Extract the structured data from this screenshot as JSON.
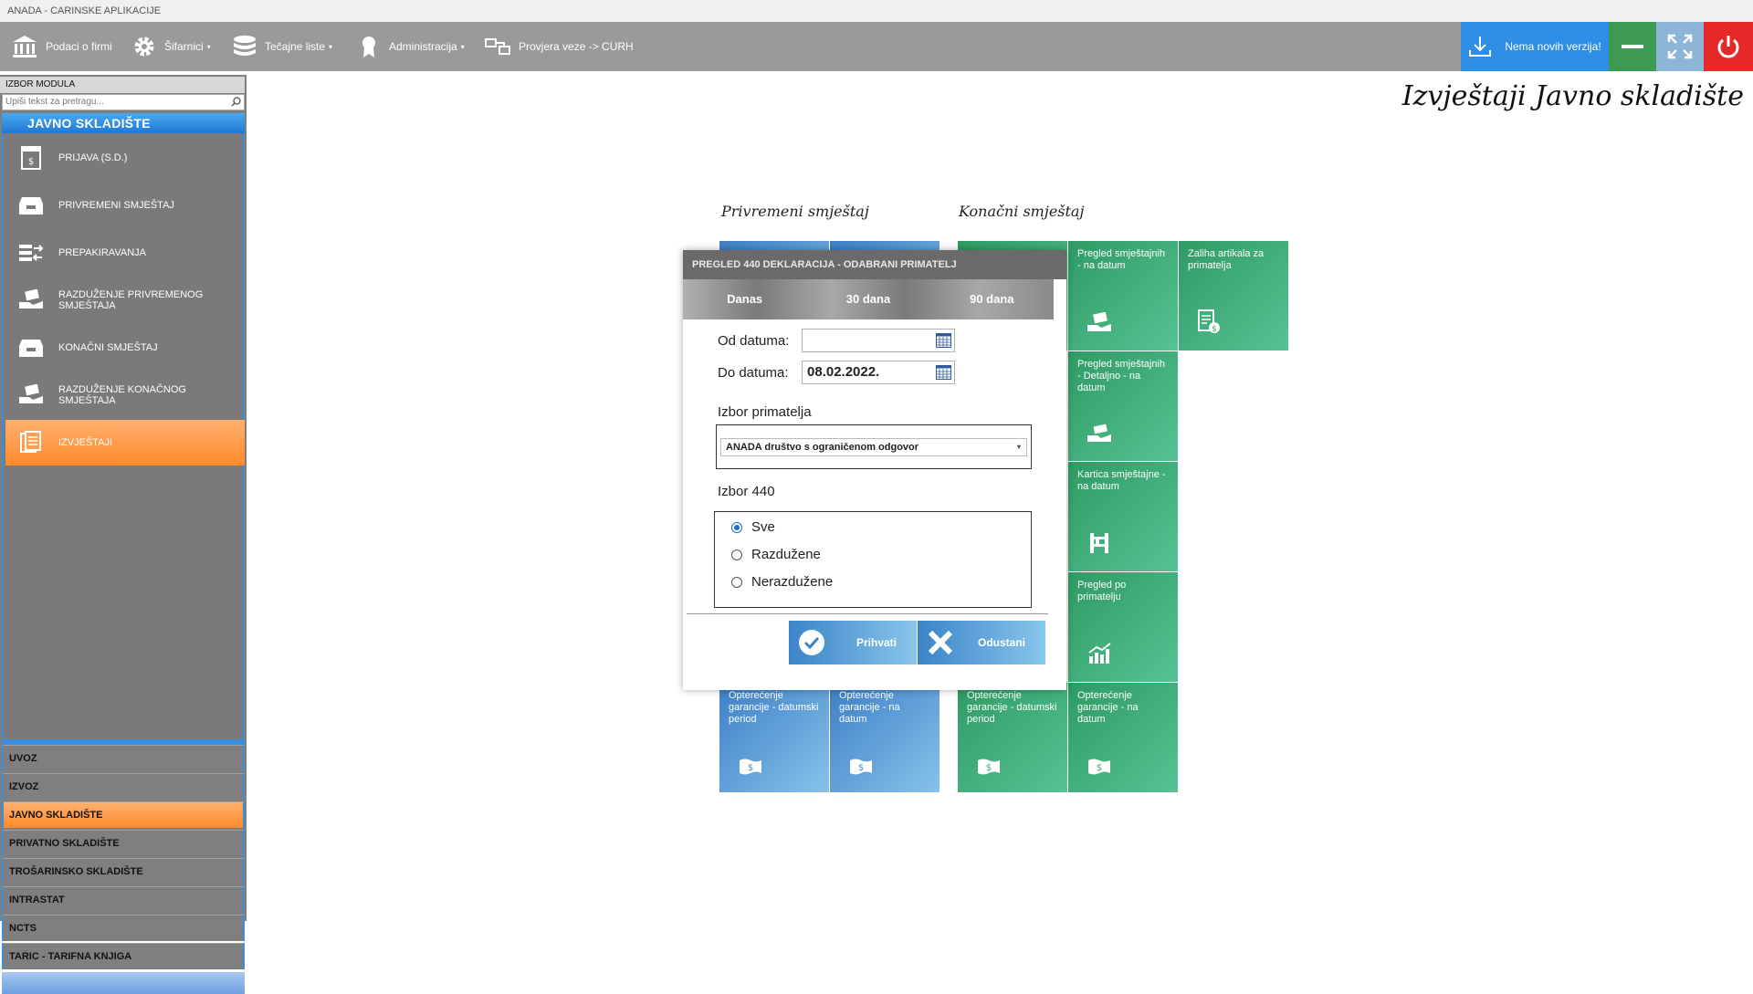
{
  "window_title": "ANADA - CARINSKE APLIKACIJE",
  "toolbar": {
    "items": [
      {
        "label": "Podaci o firmi",
        "icon": "bank-icon"
      },
      {
        "label": "Šifarnici",
        "icon": "gear-icon",
        "caret": "▾"
      },
      {
        "label": "Tečajne liste",
        "icon": "database-icon",
        "caret": "▾"
      },
      {
        "label": "Administracija",
        "icon": "award-icon",
        "caret": "▾"
      },
      {
        "label": "Provjera veze -> CURH",
        "icon": "network-icon"
      }
    ],
    "update_label": "Nema novih verzija!"
  },
  "sidebar": {
    "header": "IZBOR MODULA",
    "search_placeholder": "Upiši tekst za pretragu...",
    "module_title": "JAVNO SKLADIŠTE",
    "items": [
      {
        "label": "PRIJAVA (S.D.)",
        "icon": "document-dollar-icon"
      },
      {
        "label": "PRIVREMENI SMJEŠTAJ",
        "icon": "inbox-tray-icon"
      },
      {
        "label": "PREPAKIRAVANJA",
        "icon": "transfer-icon"
      },
      {
        "label": "RAZDUŽENJE PRIVREMENOG SMJEŠTAJA",
        "icon": "hand-box-icon"
      },
      {
        "label": "KONAČNI SMJEŠTAJ",
        "icon": "inbox-tray-icon"
      },
      {
        "label": "RAZDUŽENJE KONAČNOG SMJEŠTAJA",
        "icon": "hand-box-icon"
      },
      {
        "label": "IZVJEŠTAJI",
        "icon": "reports-icon",
        "active": true
      }
    ],
    "categories": [
      {
        "label": "UVOZ"
      },
      {
        "label": "IZVOZ"
      },
      {
        "label": "JAVNO SKLADIŠTE",
        "active": true
      },
      {
        "label": "PRIVATNO SKLADIŠTE"
      },
      {
        "label": "TROŠARINSKO SKLADIŠTE"
      },
      {
        "label": "INTRASTAT"
      },
      {
        "label": "NCTS"
      },
      {
        "label": "TARIC - TARIFNA KNJIGA"
      }
    ]
  },
  "main": {
    "title": "Izvještaji Javno skladište",
    "section_temp": "Privremeni smještaj",
    "section_final": "Konačni smještaj",
    "tiles": {
      "blue_g1": "Opterećenje garancije - datumski period",
      "blue_g2": "Opterećenje garancije - na datum",
      "green_top1": "Pregled smještajnih - na datum",
      "green_top2": "Zaliha artikala za primatelja",
      "green_r2": "Pregled smještajnih - Detaljno - na datum",
      "green_r3": "Kartica smještajne - na datum",
      "green_r4": "Pregled po primatelju",
      "green_g1": "Opterećenje garancije - datumski period",
      "green_g2": "Opterećenje garancije - na datum"
    }
  },
  "modal": {
    "title": "PREGLED 440 DEKLARACIJA - ODABRANI PRIMATELJ",
    "tabs": [
      "Danas",
      "30 dana",
      "90 dana"
    ],
    "od_label": "Od datuma:",
    "od_value": "",
    "do_label": "Do datuma:",
    "do_value": "08.02.2022.",
    "primatelj_label": "Izbor primatelja",
    "primatelj_value": "ANADA društvo s ograničenom odgovor",
    "izbor440_label": "Izbor 440",
    "options": [
      "Sve",
      "Razdužene",
      "Nerazdužene"
    ],
    "selected_option": "Sve",
    "accept_label": "Prihvati",
    "cancel_label": "Odustani"
  },
  "colors": {
    "toolbar": "#9a9a9a",
    "accent_blue": "#2e8ee6",
    "accent_orange": "#ff8a2c",
    "tile_blue": "#3d7fc6",
    "tile_green": "#2f9a63",
    "power_red": "#e52828"
  }
}
